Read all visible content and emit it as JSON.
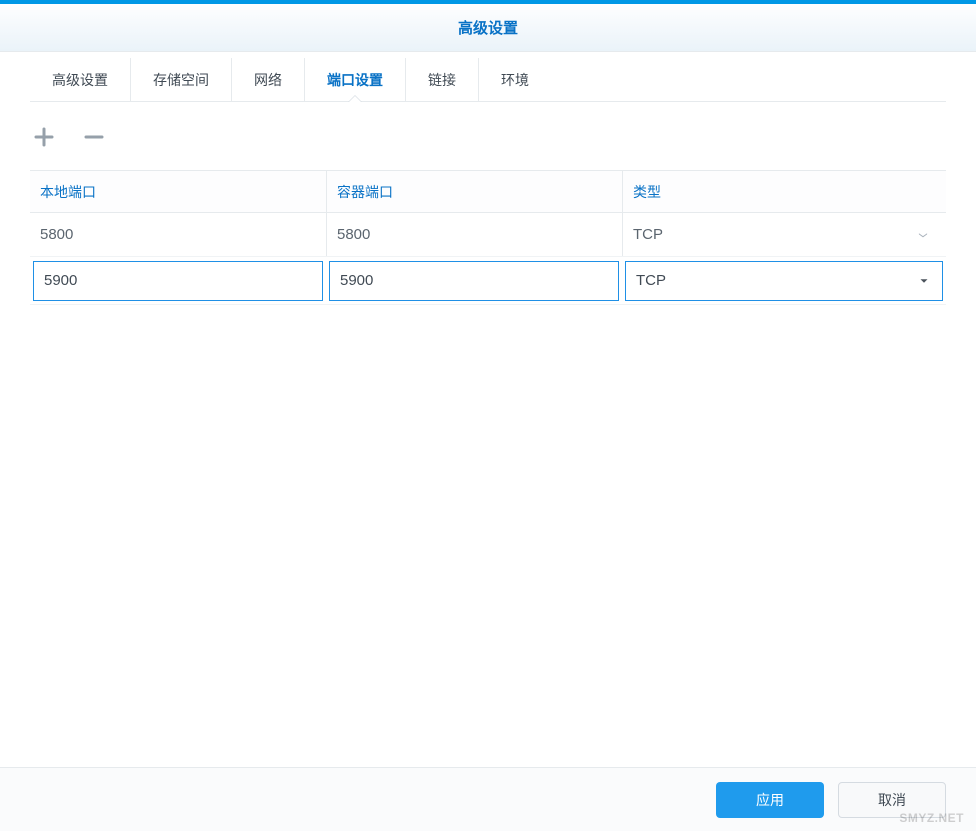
{
  "dialog": {
    "title": "高级设置"
  },
  "tabs": [
    {
      "label": "高级设置"
    },
    {
      "label": "存储空间"
    },
    {
      "label": "网络"
    },
    {
      "label": "端口设置",
      "active": true
    },
    {
      "label": "链接"
    },
    {
      "label": "环境"
    }
  ],
  "columns": {
    "local_port": "本地端口",
    "container_port": "容器端口",
    "type": "类型"
  },
  "rows": [
    {
      "local_port": "5800",
      "container_port": "5800",
      "type": "TCP",
      "editing": false
    },
    {
      "local_port": "5900",
      "container_port": "5900",
      "type": "TCP",
      "editing": true
    }
  ],
  "buttons": {
    "apply": "应用",
    "cancel": "取消"
  },
  "watermark": "SMYZ.NET"
}
